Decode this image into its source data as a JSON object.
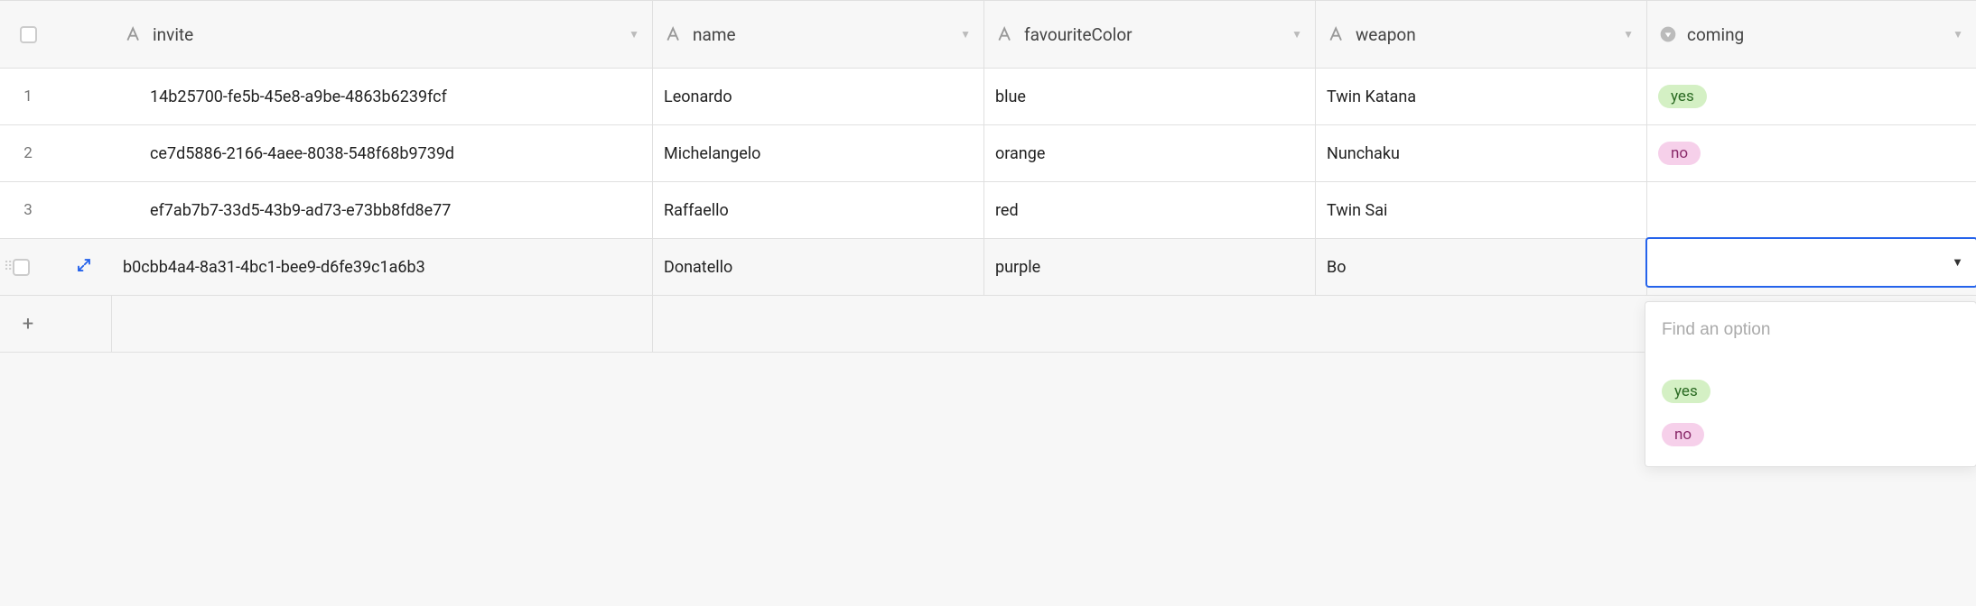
{
  "columns": {
    "invite": {
      "label": "invite",
      "type": "text"
    },
    "name": {
      "label": "name",
      "type": "text"
    },
    "color": {
      "label": "favouriteColor",
      "type": "text"
    },
    "weapon": {
      "label": "weapon",
      "type": "text"
    },
    "coming": {
      "label": "coming",
      "type": "select"
    }
  },
  "rows": [
    {
      "num": "1",
      "invite": "14b25700-fe5b-45e8-a9be-4863b6239fcf",
      "name": "Leonardo",
      "color": "blue",
      "weapon": "Twin Katana",
      "coming": "yes"
    },
    {
      "num": "2",
      "invite": "ce7d5886-2166-4aee-8038-548f68b9739d",
      "name": "Michelangelo",
      "color": "orange",
      "weapon": "Nunchaku",
      "coming": "no"
    },
    {
      "num": "3",
      "invite": "ef7ab7b7-33d5-43b9-ad73-e73bb8fd8e77",
      "name": "Raffaello",
      "color": "red",
      "weapon": "Twin Sai",
      "coming": ""
    },
    {
      "num": "",
      "invite": "b0cbb4a4-8a31-4bc1-bee9-d6fe39c1a6b3",
      "name": "Donatello",
      "color": "purple",
      "weapon": "Bo",
      "coming": ""
    }
  ],
  "dropdown": {
    "search_placeholder": "Find an option",
    "options": [
      {
        "label": "yes",
        "pillClass": "pill-yes"
      },
      {
        "label": "no",
        "pillClass": "pill-no"
      }
    ]
  },
  "pillColors": {
    "yes": "pill-yes",
    "no": "pill-no"
  }
}
